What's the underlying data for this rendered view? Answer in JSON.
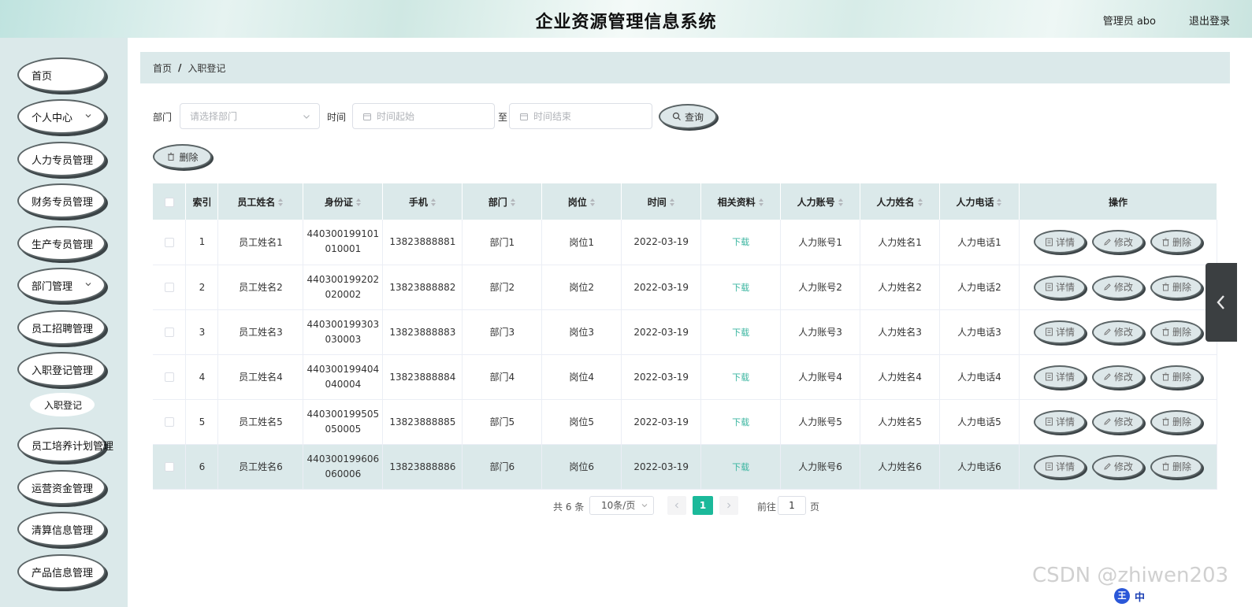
{
  "header": {
    "title": "企业资源管理信息系统",
    "user": "管理员 abo",
    "logout": "退出登录"
  },
  "sidebar": {
    "items": [
      {
        "label": "首页"
      },
      {
        "label": "个人中心"
      },
      {
        "label": "人力专员管理"
      },
      {
        "label": "财务专员管理"
      },
      {
        "label": "生产专员管理"
      },
      {
        "label": "部门管理"
      },
      {
        "label": "员工招聘管理"
      },
      {
        "label": "入职登记管理"
      },
      {
        "label": "入职登记"
      },
      {
        "label": "员工培养计划管理"
      },
      {
        "label": "运营资金管理"
      },
      {
        "label": "清算信息管理"
      },
      {
        "label": "产品信息管理"
      }
    ]
  },
  "breadcrumb": {
    "home": "首页",
    "sep": "/",
    "current": "入职登记"
  },
  "filters": {
    "dept_label": "部门",
    "dept_placeholder": "请选择部门",
    "time_label": "时间",
    "time_start_placeholder": "时间起始",
    "to_label": "至",
    "time_end_placeholder": "时间结束",
    "search_label": "查询",
    "delete_label": "删除"
  },
  "table": {
    "headers": [
      "索引",
      "员工姓名",
      "身份证",
      "手机",
      "部门",
      "岗位",
      "时间",
      "相关资料",
      "人力账号",
      "人力姓名",
      "人力电话",
      "操作"
    ],
    "rows": [
      {
        "index": "1",
        "name": "员工姓名1",
        "id_line1": "440300199101",
        "id_line2": "010001",
        "phone": "13823888881",
        "dept": "部门1",
        "post": "岗位1",
        "time": "2022-03-19",
        "doc": "下载",
        "account": "人力账号1",
        "hr_name": "人力姓名1",
        "hr_phone": "人力电话1"
      },
      {
        "index": "2",
        "name": "员工姓名2",
        "id_line1": "440300199202",
        "id_line2": "020002",
        "phone": "13823888882",
        "dept": "部门2",
        "post": "岗位2",
        "time": "2022-03-19",
        "doc": "下载",
        "account": "人力账号2",
        "hr_name": "人力姓名2",
        "hr_phone": "人力电话2"
      },
      {
        "index": "3",
        "name": "员工姓名3",
        "id_line1": "440300199303",
        "id_line2": "030003",
        "phone": "13823888883",
        "dept": "部门3",
        "post": "岗位3",
        "time": "2022-03-19",
        "doc": "下载",
        "account": "人力账号3",
        "hr_name": "人力姓名3",
        "hr_phone": "人力电话3"
      },
      {
        "index": "4",
        "name": "员工姓名4",
        "id_line1": "440300199404",
        "id_line2": "040004",
        "phone": "13823888884",
        "dept": "部门4",
        "post": "岗位4",
        "time": "2022-03-19",
        "doc": "下载",
        "account": "人力账号4",
        "hr_name": "人力姓名4",
        "hr_phone": "人力电话4"
      },
      {
        "index": "5",
        "name": "员工姓名5",
        "id_line1": "440300199505",
        "id_line2": "050005",
        "phone": "13823888885",
        "dept": "部门5",
        "post": "岗位5",
        "time": "2022-03-19",
        "doc": "下载",
        "account": "人力账号5",
        "hr_name": "人力姓名5",
        "hr_phone": "人力电话5"
      },
      {
        "index": "6",
        "name": "员工姓名6",
        "id_line1": "440300199606",
        "id_line2": "060006",
        "phone": "13823888886",
        "dept": "部门6",
        "post": "岗位6",
        "time": "2022-03-19",
        "doc": "下载",
        "account": "人力账号6",
        "hr_name": "人力姓名6",
        "hr_phone": "人力电话6"
      }
    ],
    "actions": {
      "detail": "详情",
      "edit": "修改",
      "delete": "删除"
    }
  },
  "pagination": {
    "total": "共 6 条",
    "page_size": "10条/页",
    "current": "1",
    "goto": "前往",
    "jump_value": "1",
    "page_unit": "页"
  },
  "watermark": "CSDN @zhiwen203",
  "ime": {
    "badge": "王",
    "text": "中"
  },
  "colors": {
    "accent": "#1bb99a",
    "panel": "#dbe9ea",
    "download": "#3ab5a0"
  }
}
